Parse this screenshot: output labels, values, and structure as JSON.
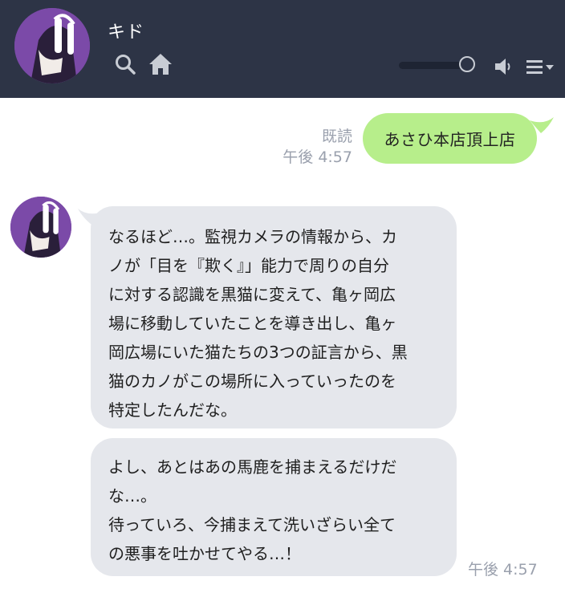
{
  "header": {
    "contact_name": "キド",
    "volume_level": 0.9
  },
  "icons": {
    "search": "search-icon",
    "home": "home-icon",
    "speaker": "speaker-icon",
    "menu": "menu-icon"
  },
  "colors": {
    "header_bg": "#2d3446",
    "sent_bubble": "#b7ee8b",
    "received_bubble": "#e5e7ec",
    "avatar_purple": "#7b4aa8"
  },
  "messages": {
    "sent": {
      "text": "あさひ本店頂上店",
      "read_label": "既読",
      "time": "午後 4:57"
    },
    "received": [
      {
        "text": "なるほど…。監視カメラの情報から、カ\nノが「目を『欺く』」能力で周りの自分\nに対する認識を黒猫に変えて、亀ヶ岡広\n場に移動していたことを導き出し、亀ヶ\n岡広場にいた猫たちの3つの証言から、黒\n猫のカノがこの場所に入っていったのを\n特定したんだな。"
      },
      {
        "text": "よし、あとはあの馬鹿を捕まえるだけだ\nな…。\n待っていろ、今捕まえて洗いざらい全て\nの悪事を吐かせてやる…！"
      }
    ],
    "received_time": "午後 4:57"
  }
}
